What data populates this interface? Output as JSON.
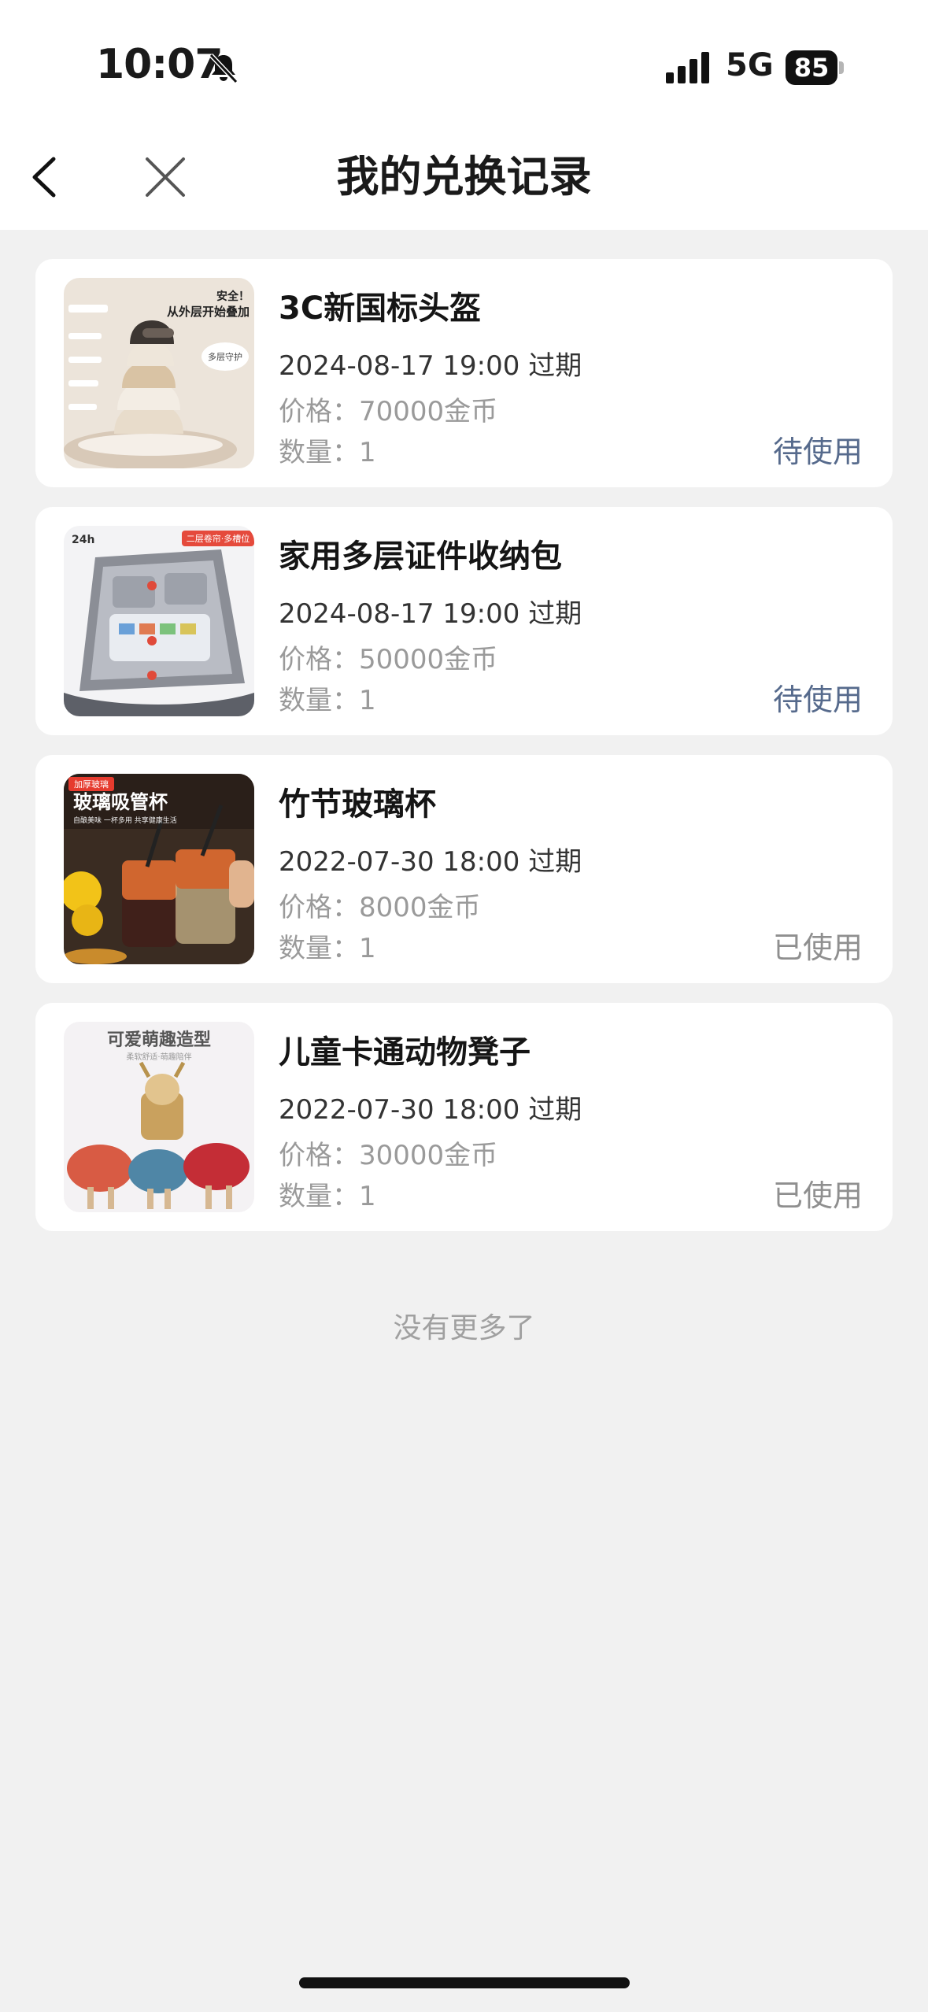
{
  "status_bar": {
    "time": "10:07",
    "network": "5G",
    "battery": "85"
  },
  "nav": {
    "title": "我的兑换记录"
  },
  "records": [
    {
      "name": "3C新国标头盔",
      "expire": "2024-08-17 19:00 过期",
      "price": "价格：70000金币",
      "quantity": "数量：1",
      "status": "待使用",
      "image_texts": [
        "安全！",
        "从外层开始叠加",
        "多层守护"
      ]
    },
    {
      "name": "家用多层证件收纳包",
      "expire": "2024-08-17 19:00 过期",
      "price": "价格：50000金币",
      "quantity": "数量：1",
      "status": "待使用",
      "image_texts": [
        "二层卷帘·多槽位",
        "24h"
      ]
    },
    {
      "name": "竹节玻璃杯",
      "expire": "2022-07-30 18:00 过期",
      "price": "价格：8000金币",
      "quantity": "数量：1",
      "status": "已使用",
      "image_texts": [
        "加厚玻璃",
        "玻璃吸管杯",
        "自酿美味 一杯多用 共享健康生活"
      ]
    },
    {
      "name": "儿童卡通动物凳子",
      "expire": "2022-07-30 18:00 过期",
      "price": "价格：30000金币",
      "quantity": "数量：1",
      "status": "已使用",
      "image_texts": [
        "可爱萌趣造型",
        "柔软舒适·萌趣陪伴"
      ]
    }
  ],
  "footer": {
    "no_more": "没有更多了"
  }
}
